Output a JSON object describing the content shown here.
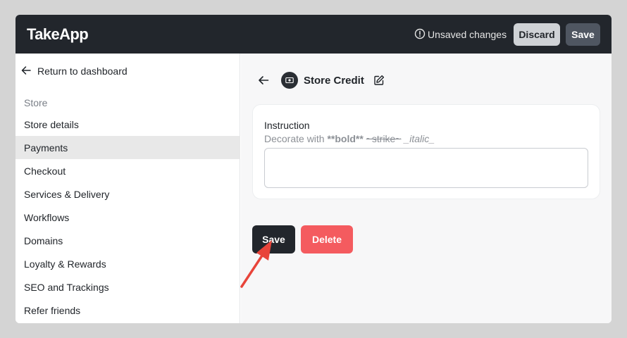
{
  "header": {
    "brand": "TakeApp",
    "unsaved_text": "Unsaved changes",
    "discard_label": "Discard",
    "save_label": "Save"
  },
  "sidebar": {
    "back_label": "Return to dashboard",
    "section_label": "Store",
    "items": [
      {
        "label": "Store details"
      },
      {
        "label": "Payments",
        "active": true
      },
      {
        "label": "Checkout"
      },
      {
        "label": "Services & Delivery"
      },
      {
        "label": "Workflows"
      },
      {
        "label": "Domains"
      },
      {
        "label": "Loyalty & Rewards"
      },
      {
        "label": "SEO and Trackings"
      },
      {
        "label": "Refer friends"
      }
    ]
  },
  "main": {
    "title": "Store Credit",
    "instruction_label": "Instruction",
    "hint": {
      "prefix": "Decorate with ",
      "bold": "**bold**",
      "strike": "~strike~",
      "italic": "_italic_"
    },
    "instruction_value": "",
    "save_label": "Save",
    "delete_label": "Delete"
  },
  "colors": {
    "topbar": "#22262c",
    "delete": "#f45b5f",
    "annotation_arrow": "#e8443a"
  }
}
